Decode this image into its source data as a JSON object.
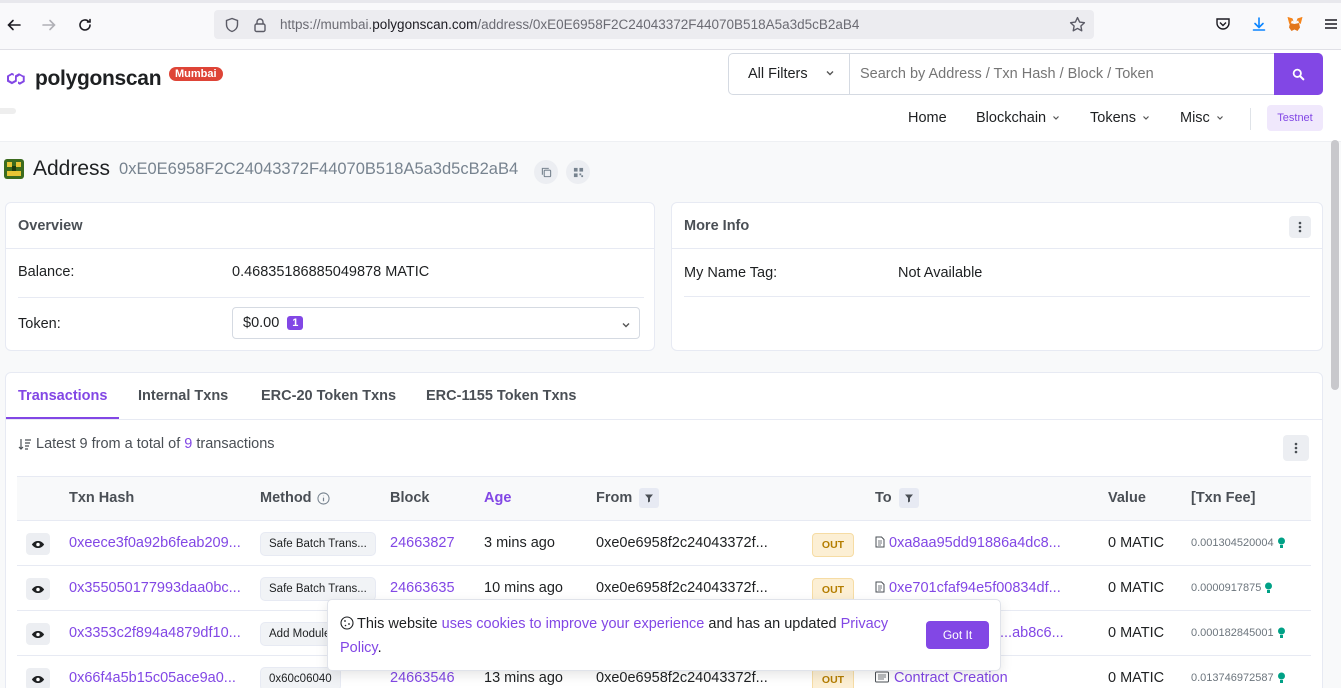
{
  "browser": {
    "url_prefix": "https://mumbai.",
    "url_host": "polygonscan.com",
    "url_path": "/address/0xE0E6958F2C24043372F44070B518A5a3d5cB2aB4"
  },
  "header": {
    "logo_text": "polygonscan",
    "network_badge": "Mumbai",
    "filter_label": "All Filters",
    "search_placeholder": "Search by Address / Txn Hash / Block / Token",
    "nav": [
      "Home",
      "Blockchain",
      "Tokens",
      "Misc"
    ],
    "testnet_label": "Testnet"
  },
  "address": {
    "label": "Address",
    "hash": "0xE0E6958F2C24043372F44070B518A5a3d5cB2aB4"
  },
  "overview": {
    "title": "Overview",
    "balance_label": "Balance:",
    "balance_value": "0.46835186885049878 MATIC",
    "token_label": "Token:",
    "token_value": "$0.00",
    "token_count": "1"
  },
  "more_info": {
    "title": "More Info",
    "name_tag_label": "My Name Tag:",
    "name_tag_value": "Not Available"
  },
  "tabs": [
    "Transactions",
    "Internal Txns",
    "ERC-20 Token Txns",
    "ERC-1155 Token Txns"
  ],
  "summary": {
    "prefix": "Latest 9 from a total of ",
    "count": "9",
    "suffix": " transactions"
  },
  "table": {
    "headers": {
      "hash": "Txn Hash",
      "method": "Method",
      "block": "Block",
      "age": "Age",
      "from": "From",
      "to": "To",
      "value": "Value",
      "fee": "[Txn Fee]"
    },
    "rows": [
      {
        "hash": "0xeece3f0a92b6feab209...",
        "method": "Safe Batch Trans...",
        "block": "24663827",
        "age": "3 mins ago",
        "from": "0xe0e6958f2c24043372f...",
        "dir": "OUT",
        "to": "0xa8aa95dd91886a4dc8...",
        "value": "0 MATIC",
        "fee": "0.001304520004"
      },
      {
        "hash": "0x355050177993daa0bc...",
        "method": "Safe Batch Trans...",
        "block": "24663635",
        "age": "10 mins ago",
        "from": "0xe0e6958f2c24043372f...",
        "dir": "OUT",
        "to": "0xe701cfaf94e5f00834df...",
        "value": "0 MATIC",
        "fee": "0.0000917875"
      },
      {
        "hash": "0x3353c2f894a4879df10...",
        "method": "Add Module",
        "block": "",
        "age": "",
        "from": "",
        "dir": "",
        "to": "...ab8c6...",
        "value": "0 MATIC",
        "fee": "0.000182845001"
      },
      {
        "hash": "0x66f4a5b15c05ace9a0...",
        "method": "0x60c06040",
        "block": "24663546",
        "age": "13 mins ago",
        "from": "0xe0e6958f2c24043372f...",
        "dir": "OUT",
        "to": "Contract Creation",
        "value": "0 MATIC",
        "fee": "0.013746972587"
      }
    ]
  },
  "cookie": {
    "text1": "This website ",
    "link1": "uses cookies to improve your experience",
    "text2": " and has an updated ",
    "link2": "Privacy Policy",
    "text3": ".",
    "button": "Got It"
  },
  "colors": {
    "accent": "#8247e5",
    "badge_red": "#de4437",
    "out_badge": "#fcefd4"
  }
}
